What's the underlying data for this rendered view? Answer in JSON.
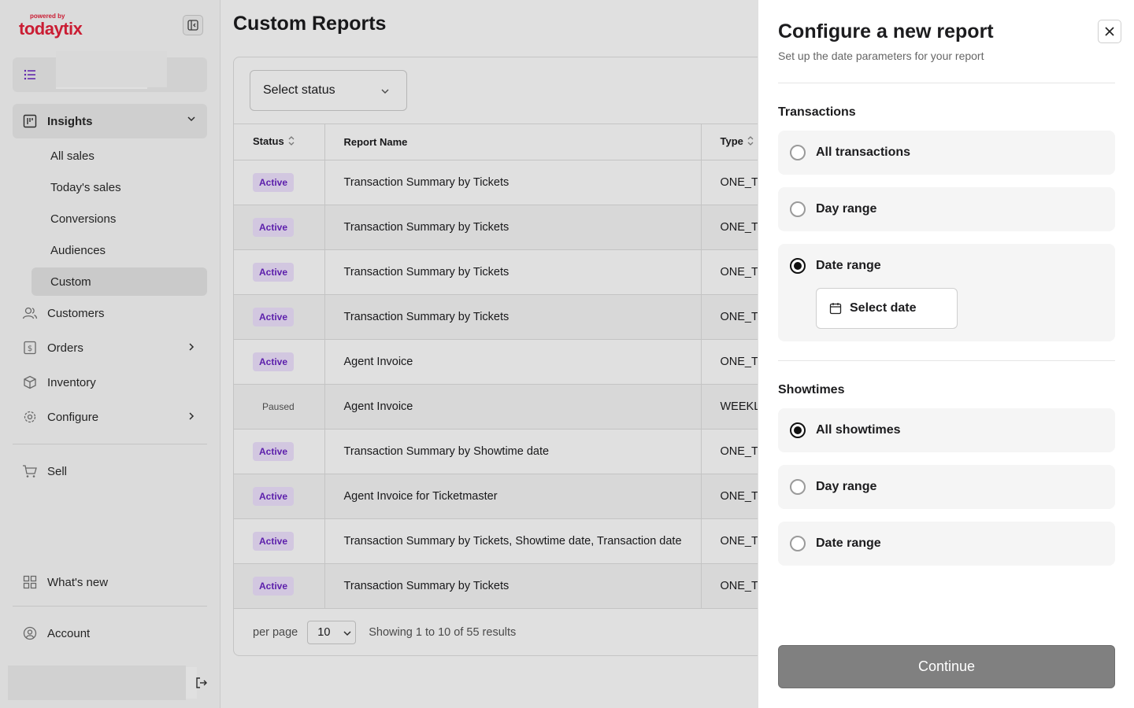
{
  "logo": {
    "powered_by": "powered by",
    "brand": "todaytix"
  },
  "sidebar": {
    "insights": "Insights",
    "sub_items": [
      "All sales",
      "Today's sales",
      "Conversions",
      "Audiences",
      "Custom"
    ],
    "customers": "Customers",
    "orders": "Orders",
    "inventory": "Inventory",
    "configure": "Configure",
    "sell": "Sell",
    "whats_new": "What's new",
    "account": "Account"
  },
  "main": {
    "title": "Custom Reports",
    "status_select": "Select status",
    "columns": {
      "status": "Status",
      "report_name": "Report Name",
      "type": "Type"
    },
    "rows": [
      {
        "status": "Active",
        "name": "Transaction Summary by Tickets",
        "type": "ONE_TI"
      },
      {
        "status": "Active",
        "name": "Transaction Summary by Tickets",
        "type": "ONE_TI"
      },
      {
        "status": "Active",
        "name": "Transaction Summary by Tickets",
        "type": "ONE_TI"
      },
      {
        "status": "Active",
        "name": "Transaction Summary by Tickets",
        "type": "ONE_TI"
      },
      {
        "status": "Active",
        "name": "Agent Invoice",
        "type": "ONE_TI"
      },
      {
        "status": "Paused",
        "name": "Agent Invoice",
        "type": "WEEKLY"
      },
      {
        "status": "Active",
        "name": "Transaction Summary by Showtime date",
        "type": "ONE_TI"
      },
      {
        "status": "Active",
        "name": "Agent Invoice for Ticketmaster",
        "type": "ONE_TI"
      },
      {
        "status": "Active",
        "name": "Transaction Summary by Tickets, Showtime date, Transaction date",
        "type": "ONE_TI"
      },
      {
        "status": "Active",
        "name": "Transaction Summary by Tickets",
        "type": "ONE_TI"
      }
    ],
    "pager": {
      "per_page_label": "per page",
      "per_page_value": "10",
      "results": "Showing 1 to 10 of 55 results"
    }
  },
  "drawer": {
    "title": "Configure a new report",
    "subtitle": "Set up the date parameters for your report",
    "transactions": {
      "title": "Transactions",
      "options": [
        "All transactions",
        "Day range",
        "Date range"
      ],
      "selected": 2,
      "date_button": "Select date"
    },
    "showtimes": {
      "title": "Showtimes",
      "options": [
        "All showtimes",
        "Day range",
        "Date range"
      ],
      "selected": 0
    },
    "continue": "Continue"
  },
  "colors": {
    "brand": "#e6213b",
    "active_badge_bg": "#efe3ff",
    "active_badge_text": "#6a25c4",
    "continue_bg": "#808080"
  }
}
